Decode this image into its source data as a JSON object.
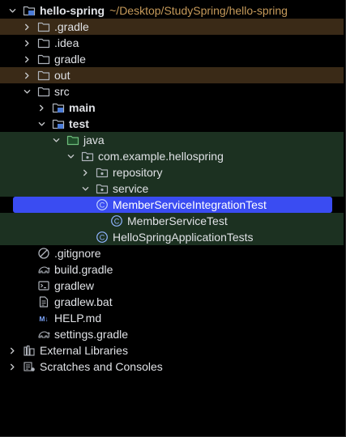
{
  "project": {
    "name": "hello-spring",
    "path": "~/Desktop/StudySpring/hello-spring"
  },
  "items": {
    "gradle_hidden": ".gradle",
    "idea": ".idea",
    "gradle": "gradle",
    "out": "out",
    "src": "src",
    "main": "main",
    "test": "test",
    "java": "java",
    "package": "com.example.hellospring",
    "repository": "repository",
    "service": "service",
    "integration_test": "MemberServiceIntegrationTest",
    "service_test": "MemberServiceTest",
    "app_tests": "HelloSpringApplicationTests",
    "gitignore": ".gitignore",
    "build_gradle": "build.gradle",
    "gradlew": "gradlew",
    "gradlew_bat": "gradlew.bat",
    "help_md": "HELP.md",
    "settings_gradle": "settings.gradle",
    "external_libraries": "External Libraries",
    "scratches": "Scratches and Consoles"
  },
  "icons": {
    "markdown_badge": "M↓",
    "class_letter": "C"
  },
  "colors": {
    "background": "#000000",
    "selection": "#3a4cf2",
    "excluded_row": "#3a2a17",
    "test_source_row": "#1c3121",
    "path_text": "#c69a5a"
  }
}
